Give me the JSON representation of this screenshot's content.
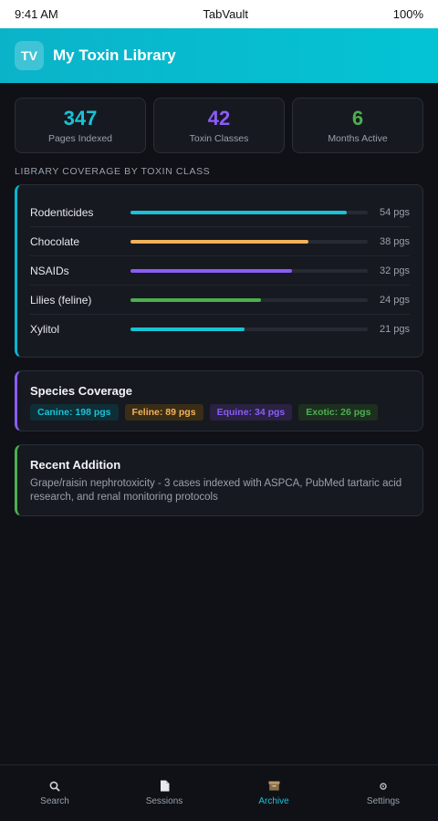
{
  "status_bar": {
    "time": "9:41 AM",
    "app": "TabVault",
    "battery": "100%"
  },
  "header": {
    "logo": "TV",
    "title": "My Toxin Library"
  },
  "stats": [
    {
      "value": "347",
      "label": "Pages Indexed",
      "color": "#19c3d6"
    },
    {
      "value": "42",
      "label": "Toxin Classes",
      "color": "#8b5cf6"
    },
    {
      "value": "6",
      "label": "Months Active",
      "color": "#4caf50"
    }
  ],
  "coverage": {
    "title": "LIBRARY COVERAGE BY TOXIN CLASS",
    "accent": "#06b6d4",
    "items": [
      {
        "name": "Rodenticides",
        "pages": "54 pgs",
        "fill": 0.91,
        "color": "#19c3d6"
      },
      {
        "name": "Chocolate",
        "pages": "38 pgs",
        "fill": 0.75,
        "color": "#f3b25a"
      },
      {
        "name": "NSAIDs",
        "pages": "32 pgs",
        "fill": 0.68,
        "color": "#8b5cf6"
      },
      {
        "name": "Lilies (feline)",
        "pages": "24 pgs",
        "fill": 0.55,
        "color": "#4caf50"
      },
      {
        "name": "Xylitol",
        "pages": "21 pgs",
        "fill": 0.48,
        "color": "#19c3d6"
      }
    ]
  },
  "species": {
    "title": "Species Coverage",
    "accent": "#8b5cf6",
    "tags": [
      {
        "label": "Canine: 198 pgs",
        "color": "#19c3d6",
        "bg": "#0f2e36"
      },
      {
        "label": "Feline: 89 pgs",
        "color": "#f3b25a",
        "bg": "#3a2d17"
      },
      {
        "label": "Equine: 34 pgs",
        "color": "#8b5cf6",
        "bg": "#2a2143"
      },
      {
        "label": "Exotic: 26 pgs",
        "color": "#4caf50",
        "bg": "#1d3020"
      }
    ]
  },
  "recent": {
    "title": "Recent Addition",
    "accent": "#4caf50",
    "text": "Grape/raisin nephrotoxicity - 3 cases indexed with ASPCA, PubMed tartaric acid research, and renal monitoring protocols"
  },
  "nav": {
    "items": [
      {
        "label": "Search",
        "icon": "search-icon",
        "active": false
      },
      {
        "label": "Sessions",
        "icon": "document-icon",
        "active": false
      },
      {
        "label": "Archive",
        "icon": "archive-icon",
        "active": true
      },
      {
        "label": "Settings",
        "icon": "gear-icon",
        "active": false
      }
    ]
  }
}
